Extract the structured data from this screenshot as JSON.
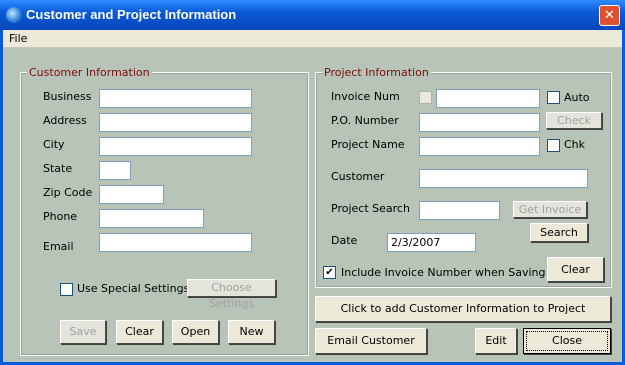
{
  "window": {
    "title": "Customer and Project Information",
    "close_glyph": "✕"
  },
  "menu": {
    "file": "File"
  },
  "customer": {
    "legend": "Customer Information",
    "business_label": "Business",
    "address_label": "Address",
    "city_label": "City",
    "state_label": "State",
    "zip_label": "Zip Code",
    "phone_label": "Phone",
    "email_label": "Email",
    "business": "",
    "address": "",
    "city": "",
    "state": "",
    "zip": "",
    "phone": "",
    "email": "",
    "special_settings_label": "Use Special Settings",
    "special_settings_checked": false,
    "choose_settings": "Choose Settings",
    "save": "Save",
    "clear": "Clear",
    "open": "Open",
    "new": "New"
  },
  "project": {
    "legend": "Project Information",
    "invoice_label": "Invoice Num",
    "invoice": "",
    "auto_label": "Auto",
    "po_label": "P.O. Number",
    "po": "",
    "check": "Check",
    "name_label": "Project Name",
    "name": "",
    "chk_label": "Chk",
    "customer_label": "Customer",
    "customer": "",
    "search_label": "Project Search",
    "search": "",
    "get_invoice": "Get Invoice",
    "search_button": "Search",
    "date_label": "Date",
    "date": "2/3/2007",
    "include_invoice_label": "Include Invoice Number when Saving",
    "include_invoice_checked": true,
    "clear": "Clear"
  },
  "footer": {
    "add_customer": "Click to add Customer Information to Project",
    "email_customer": "Email Customer",
    "edit": "Edit",
    "close": "Close"
  },
  "colors": {
    "client_bg": "#B8C4B8",
    "legend_text": "#7B0F0F",
    "titlebar": "#0A5BD8"
  }
}
